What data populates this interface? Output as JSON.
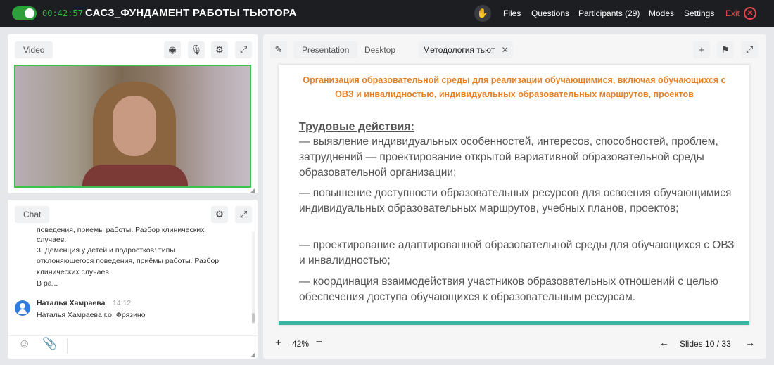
{
  "header": {
    "timer": "00:42:57",
    "title": "САСЗ_ФУНДАМЕНТ РАБОТЫ ТЬЮТОРА",
    "menu": [
      "Files",
      "Questions",
      "Participants (29)",
      "Modes",
      "Settings"
    ],
    "exit_label": "Exit"
  },
  "video": {
    "tab_label": "Video"
  },
  "chat": {
    "tab_label": "Chat",
    "messages_prev": [
      "поведения, приемы работы. Разбор клинических",
      "случаев.",
      "3. Деменция у детей и подростков: типы",
      "отклоняющегося поведения, приёмы работы. Разбор",
      "клинических случаев.",
      "В ра..."
    ],
    "last_author": "Наталья Хамраева",
    "last_time": "14:12",
    "last_text": "Наталья Хамраева г.о. Фрязино"
  },
  "presentation": {
    "tabs": [
      "Presentation",
      "Desktop"
    ],
    "doc_tab": "Методология тьют",
    "zoom": "42%",
    "slides_label": "Slides",
    "current_slide": "10",
    "total_slides": "33",
    "slide": {
      "title": "Организация образовательной среды для реализации обучающимися, включая обучающихся с ОВЗ и инвалидностью, индивидуальных образовательных маршрутов, проектов",
      "heading": "Трудовые действия:",
      "items": [
        "— выявление индивидуальных особенностей, интересов, способностей, проблем, затруднений — проектирование открытой вариативной образовательной среды образовательной организации;",
        "— повышение доступности образовательных ресурсов для освоения обучающимися индивидуальных образовательных маршрутов, учебных планов, проектов;",
        "— проектирование адаптированной образовательной среды для обучающихся с ОВЗ и инвалидностью;",
        "— координация взаимодействия участников образовательных отношений с целью обеспечения доступа обучающихся к образовательным ресурсам."
      ]
    }
  },
  "colors": {
    "accent_green": "#3cb34a",
    "exit_red": "#e5484d",
    "slide_orange": "#e67e22",
    "slide_stripe": "#3cb2a1"
  }
}
